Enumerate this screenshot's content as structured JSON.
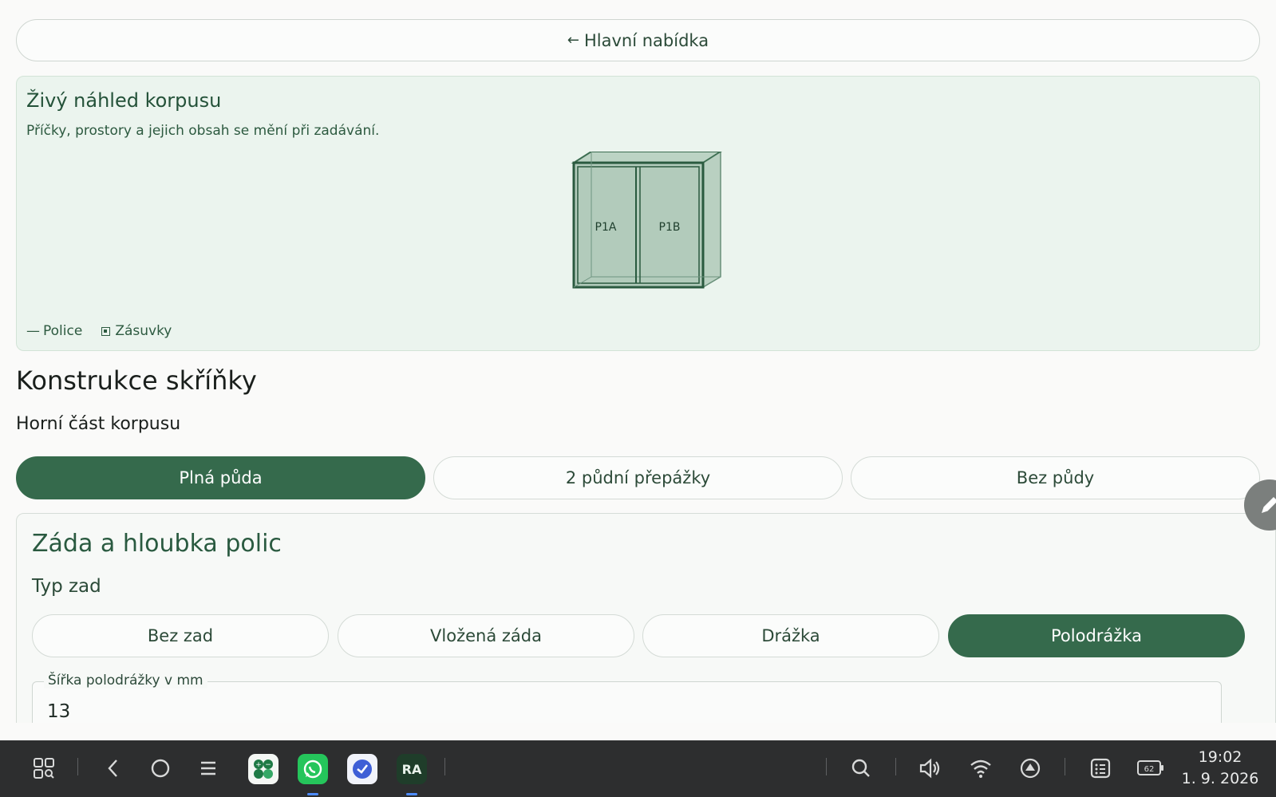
{
  "nav": {
    "back_arrow": "←",
    "back_label": "Hlavní nabídka"
  },
  "preview": {
    "title": "Živý náhled korpusu",
    "subtitle": "Příčky, prostory a jejich obsah se mění při zadávání.",
    "sections": [
      "P1A",
      "P1B"
    ],
    "legend": {
      "shelves_dash": "—",
      "shelves": "Police",
      "drawers": "Zásuvky"
    }
  },
  "construction": {
    "title": "Konstrukce skříňky",
    "top_label": "Horní část korpusu",
    "top_options": [
      {
        "label": "Plná půda",
        "active": true
      },
      {
        "label": "2 půdní přepážky",
        "active": false
      },
      {
        "label": "Bez půdy",
        "active": false
      }
    ]
  },
  "back_depth": {
    "title": "Záda a hloubka polic",
    "type_label": "Typ zad",
    "options": [
      {
        "label": "Bez zad",
        "active": false
      },
      {
        "label": "Vložená záda",
        "active": false
      },
      {
        "label": "Drážka",
        "active": false
      },
      {
        "label": "Polodrážka",
        "active": true
      }
    ],
    "groove_width_label": "Šířka polodrážky v mm",
    "groove_width_value": "13"
  },
  "taskbar": {
    "time": "19:02",
    "date": "1. 9. 2026",
    "battery": "62",
    "icons": [
      "apps-grid-icon",
      "back-icon",
      "home-icon",
      "menu-icon",
      "calculator-app-icon",
      "whatsapp-app-icon",
      "clock-app-icon",
      "ra-app-icon",
      "search-icon",
      "volume-icon",
      "wifi-icon",
      "upload-icon",
      "notes-icon",
      "battery-icon"
    ]
  },
  "colors": {
    "accent": "#356a4c",
    "preview_bg": "#ebf4ee",
    "taskbar": "#2d2e2f"
  }
}
